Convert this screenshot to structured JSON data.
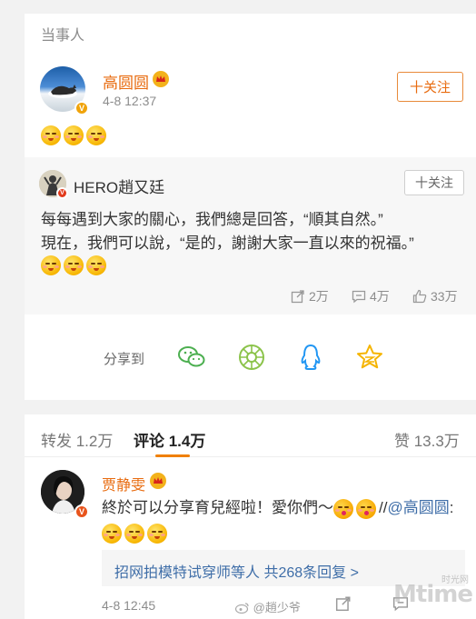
{
  "section": {
    "label": "当事人"
  },
  "post": {
    "author": "高圆圆",
    "time": "4-8 12:37",
    "follow_label": "十关注"
  },
  "repost": {
    "author": "HERO趙又廷",
    "follow_label": "十关注",
    "line1": "每每遇到大家的關心，我們總是回答，“順其自然。”",
    "line2": "現在，我們可以說，“是的，謝謝大家一直以來的祝福。”",
    "shares": "2万",
    "comments": "4万",
    "likes": "33万"
  },
  "share": {
    "label": "分享到",
    "targets": [
      "wechat-icon",
      "moments-icon",
      "qq-icon",
      "qzone-icon"
    ]
  },
  "tabs": {
    "repost": "转发 1.2万",
    "comment": "评论 1.4万",
    "like": "赞 13.3万"
  },
  "comment": {
    "author": "贾静雯",
    "text_prefix": "終於可以分享育兒經啦！愛你們～",
    "mention_prefix": "//",
    "mention": "@高圆圆",
    "colon": ":",
    "replies_text": "招网拍模特试穿师等人",
    "replies_count": "共268条回复 >",
    "time": "4-8 12:45"
  },
  "watermark": {
    "handle": "@趙少爷",
    "logo_top": "时光网",
    "logo_main": "Mtime"
  },
  "colors": {
    "accent": "#e86b0f",
    "link": "#3f6ea8",
    "tab_underline": "#f08000"
  }
}
